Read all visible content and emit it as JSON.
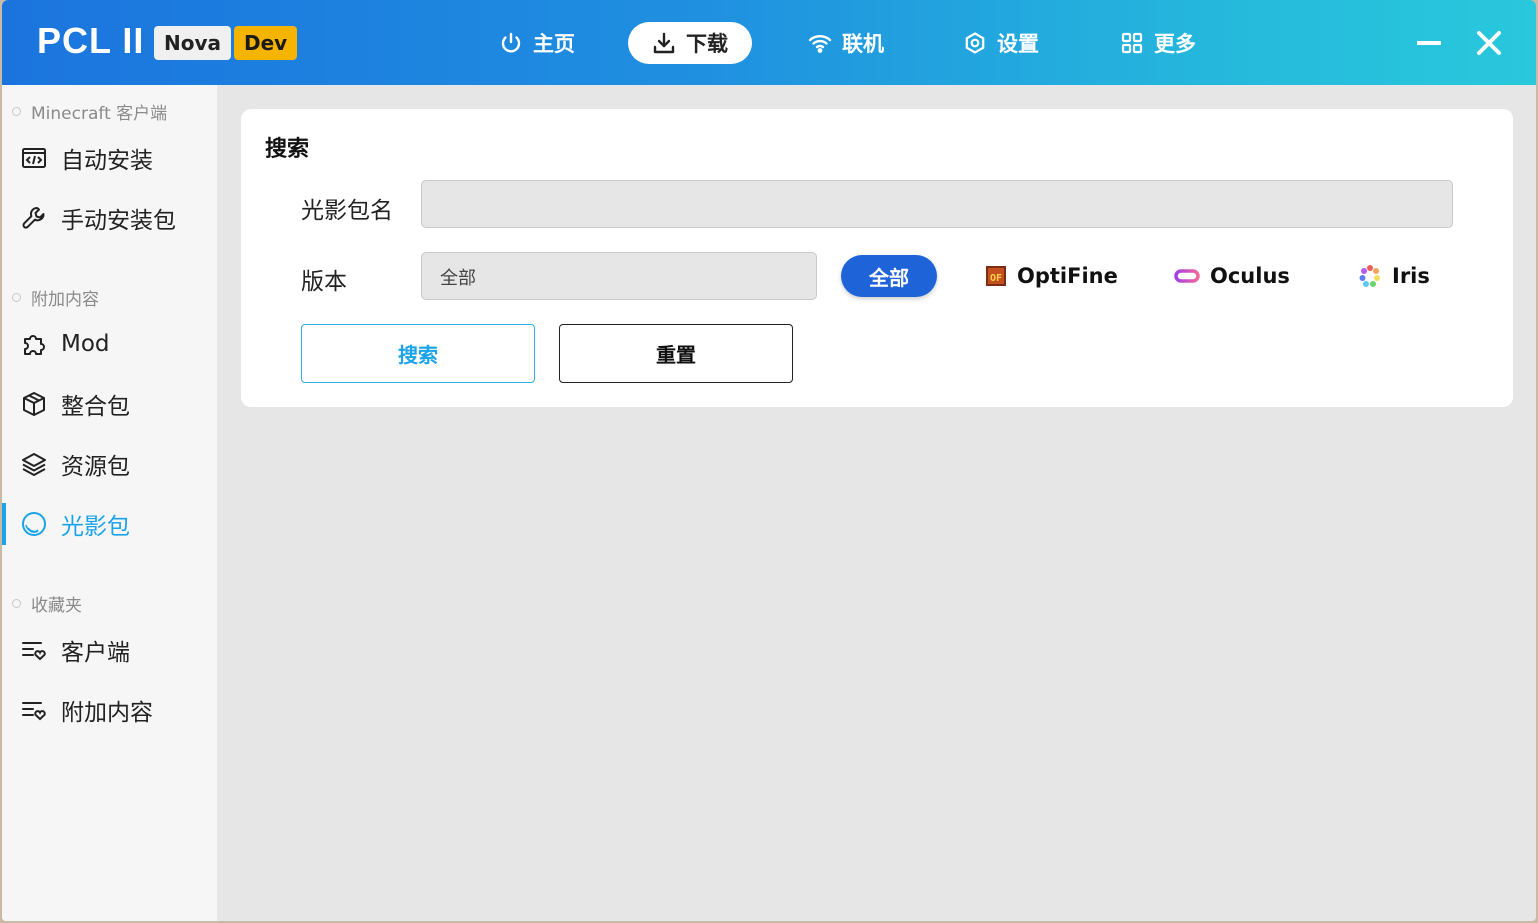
{
  "titlebar": {
    "logo": "PCL II",
    "badge_nova": "Nova",
    "badge_dev": "Dev",
    "nav": [
      {
        "label": "主页",
        "icon": "power-icon"
      },
      {
        "label": "下载",
        "icon": "download-icon"
      },
      {
        "label": "联机",
        "icon": "wifi-icon"
      },
      {
        "label": "设置",
        "icon": "settings-icon"
      },
      {
        "label": "更多",
        "icon": "grid-icon"
      }
    ],
    "minimize_icon": "minimize-icon",
    "close_icon": "close-icon",
    "gradient_start": "#1b74de",
    "gradient_end": "#29c8dc"
  },
  "sidebar": {
    "sections": [
      {
        "label": "Minecraft 客户端"
      },
      {
        "label": "附加内容"
      },
      {
        "label": "收藏夹"
      }
    ],
    "items": [
      {
        "label": "自动安装",
        "icon": "code-window-icon"
      },
      {
        "label": "手动安装包",
        "icon": "wrench-icon"
      },
      {
        "label": "Mod",
        "icon": "puzzle-icon"
      },
      {
        "label": "整合包",
        "icon": "box-icon"
      },
      {
        "label": "资源包",
        "icon": "layers-icon"
      },
      {
        "label": "光影包",
        "icon": "shader-icon",
        "active": true
      },
      {
        "label": "客户端",
        "icon": "favorite-list-icon"
      },
      {
        "label": "附加内容",
        "icon": "favorite-list-icon"
      }
    ],
    "accent_color": "#1aa3e8"
  },
  "search": {
    "title": "搜索",
    "name_label": "光影包名",
    "name_value": "",
    "version_label": "版本",
    "version_value": "全部",
    "loaders": [
      {
        "label": "全部",
        "active": true
      },
      {
        "label": "OptiFine",
        "icon": "optifine-icon"
      },
      {
        "label": "Oculus",
        "icon": "oculus-icon"
      },
      {
        "label": "Iris",
        "icon": "iris-icon"
      }
    ],
    "search_button": "搜索",
    "reset_button": "重置"
  }
}
